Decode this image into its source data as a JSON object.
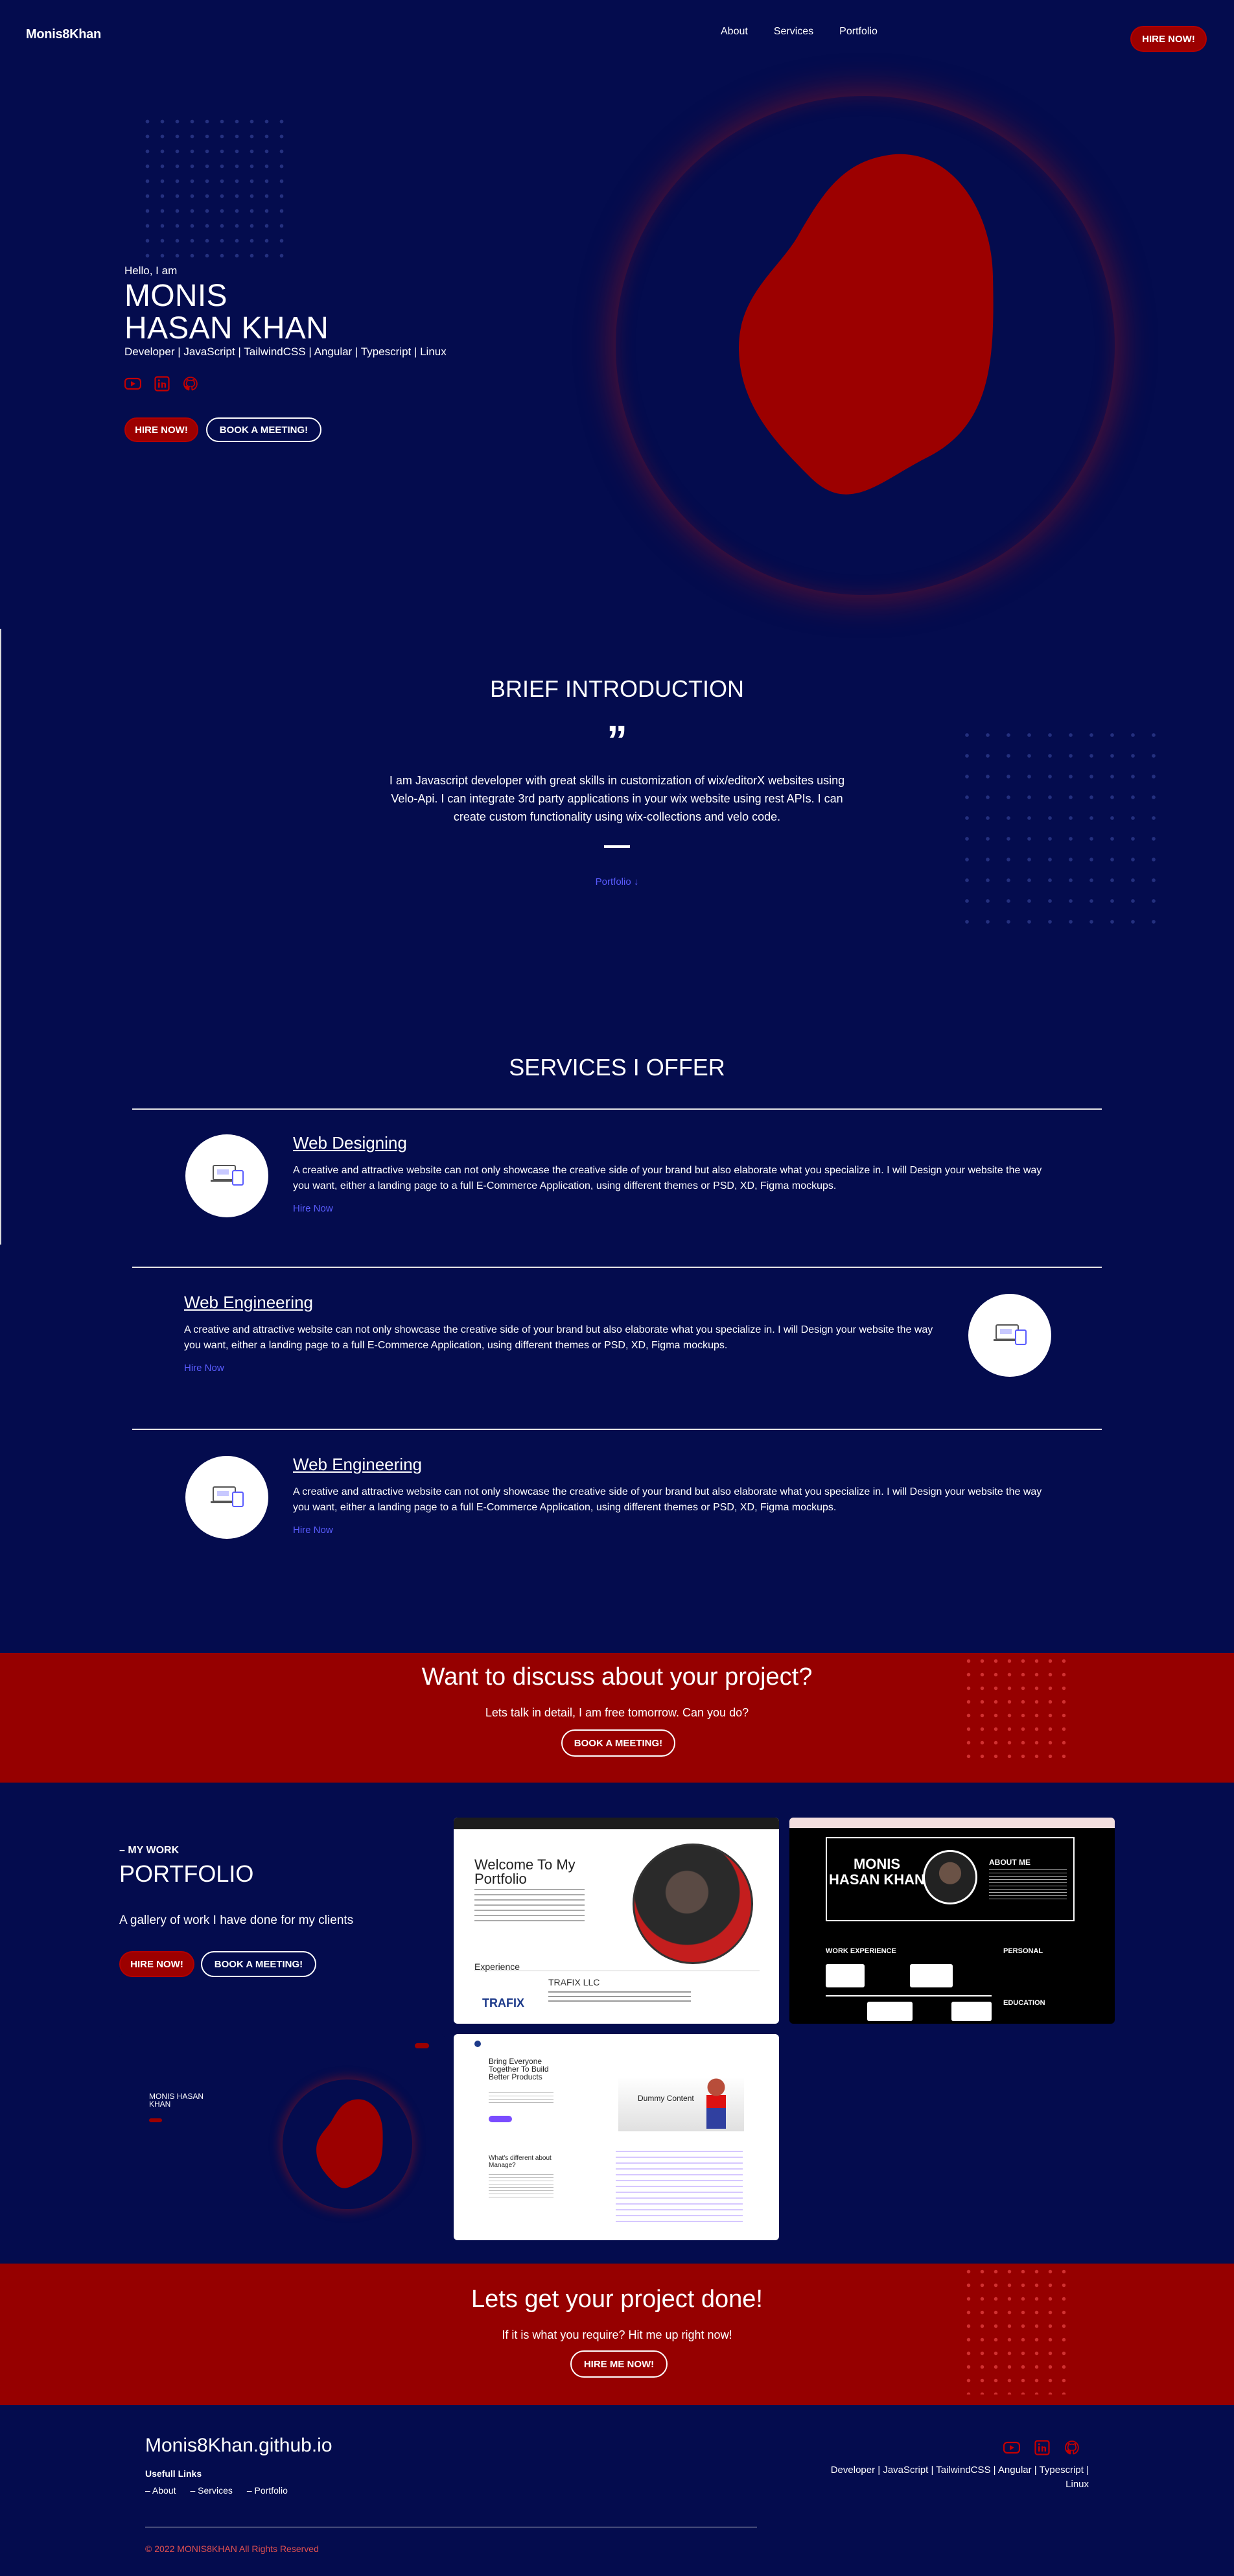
{
  "nav": {
    "logo": "Monis8Khan",
    "links": [
      "About",
      "Services",
      "Portfolio"
    ],
    "hire_label": "HIRE NOW!"
  },
  "hero": {
    "greeting": "Hello, I am",
    "name_line1": "MONIS",
    "name_line2": "HASAN KHAN",
    "skills": "Developer | JavaScript | TailwindCSS | Angular | Typescript | Linux",
    "hire_label": "HIRE NOW!",
    "meeting_label": "BOOK A MEETING!",
    "social_icons": [
      "youtube-icon",
      "linkedin-icon",
      "github-icon"
    ]
  },
  "intro": {
    "title": "BRIEF INTRODUCTION",
    "quote_mark": "”",
    "text": "I am Javascript developer with great skills in customization of wix/editorX websites using Velo-Api. I can integrate 3rd party applications in your wix website using rest APIs. I can create custom functionality using wix-collections and velo code.",
    "portfolio_link": "Portfolio ↓"
  },
  "services": {
    "title": "SERVICES I OFFER",
    "items": [
      {
        "title": "Web Designing",
        "text": "A creative and attractive website can not only showcase the creative side of your brand but also elaborate what you specialize in. I will Design your website the way you want, either a landing page to a full E-Commerce Application, using different themes or PSD, XD, Figma mockups.",
        "link": "Hire Now"
      },
      {
        "title": "Web Engineering",
        "text": "A creative and attractive website can not only showcase the creative side of your brand but also elaborate what you specialize in. I will Design your website the way you want, either a landing page to a full E-Commerce Application, using different themes or PSD, XD, Figma mockups.",
        "link": "Hire Now"
      },
      {
        "title": "Web Engineering",
        "text": "A creative and attractive website can not only showcase the creative side of your brand but also elaborate what you specialize in. I will Design your website the way you want, either a landing page to a full E-Commerce Application, using different themes or PSD, XD, Figma mockups.",
        "link": "Hire Now"
      }
    ]
  },
  "discuss": {
    "title": "Want to discuss about your project?",
    "subtitle": "Lets talk in detail, I am free tomorrow. Can you do?",
    "button": "BOOK A MEETING!"
  },
  "portfolio": {
    "kicker": "– MY WORK",
    "title": "PORTFOLIO",
    "description": "A gallery of work I have done for my clients",
    "hire_label": "HIRE NOW!",
    "meeting_label": "BOOK A MEETING!",
    "shot1": {
      "heading": "Welcome To My Portfolio",
      "experience": "Experience",
      "company": "TRAFIX LLC",
      "logo": "TRAFIX"
    },
    "shot2": {
      "name": "MONIS HASAN KHAN",
      "about": "ABOUT ME",
      "work": "WORK EXPERIENCE",
      "personal": "PERSONAL",
      "education": "EDUCATION"
    },
    "shot3": {
      "name": "MONIS HASAN KHAN"
    },
    "shot4": {
      "heading": "Bring Everyone Together To Build Better Products",
      "dummy": "Dummy Content",
      "diff": "What's different about Manage?"
    }
  },
  "cta": {
    "title": "Lets get your project done!",
    "subtitle": "If it is what you require? Hit me up right now!",
    "button": "HIRE ME NOW!"
  },
  "footer": {
    "site": "Monis8Khan.github.io",
    "links_title": "Usefull Links",
    "links": [
      "– About",
      "– Services",
      "– Portfolio"
    ],
    "skills_line1": "Developer | JavaScript | TailwindCSS | Angular | Typescript |",
    "skills_line2": "Linux",
    "copyright": "© 2022 MONIS8KHAN All Rights Reserved"
  },
  "colors": {
    "background": "#040c4e",
    "accent_red": "#9c0000",
    "link_blue": "#5a5cff"
  }
}
